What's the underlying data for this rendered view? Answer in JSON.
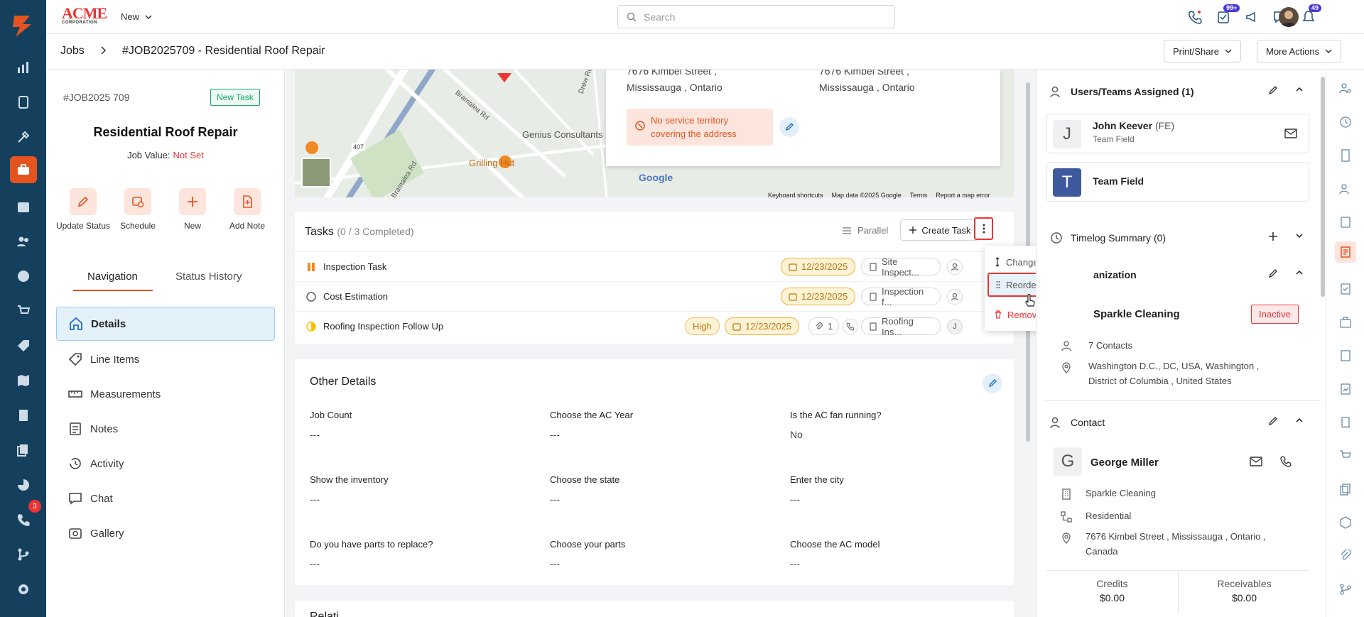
{
  "topbar": {
    "brand": "ACME",
    "brand_sub": "CORPORATION",
    "new_label": "New",
    "search_placeholder": "Search",
    "notif_badge_1": "99+",
    "notif_badge_2": "49"
  },
  "rail": {
    "badge": "3"
  },
  "breadcrumb": {
    "root": "Jobs",
    "current": "#JOB2025709 - Residential Roof Repair",
    "print_share": "Print/Share",
    "more_actions": "More Actions"
  },
  "job": {
    "id": "#JOB2025 709",
    "tag": "New Task",
    "title": "Residential Roof Repair",
    "value_label": "Job Value:",
    "value": "Not Set"
  },
  "quick_actions": [
    {
      "label": "Update Status",
      "icon": "pencil-icon"
    },
    {
      "label": "Schedule",
      "icon": "calendar-clock-icon"
    },
    {
      "label": "New",
      "icon": "plus-icon"
    },
    {
      "label": "Add Note",
      "icon": "note-add-icon"
    }
  ],
  "left_tabs": [
    "Navigation",
    "Status History"
  ],
  "nav": [
    {
      "label": "Details",
      "icon": "home-icon"
    },
    {
      "label": "Line Items",
      "icon": "tag-icon"
    },
    {
      "label": "Measurements",
      "icon": "ruler-icon"
    },
    {
      "label": "Notes",
      "icon": "notes-icon"
    },
    {
      "label": "Activity",
      "icon": "history-icon"
    },
    {
      "label": "Chat",
      "icon": "chat-icon"
    },
    {
      "label": "Gallery",
      "icon": "gallery-icon"
    }
  ],
  "map": {
    "labels": [
      "Genius Consultants",
      "Grilling Hut",
      "Bramalea Rd",
      "Bramalea Rd",
      "Drew Rd",
      "407"
    ],
    "card_addr_1_line1": "7676 Kimbel Street ,",
    "card_addr_1_line2": "Mississauga , Ontario",
    "card_addr_2_line1": "7676 Kimbel Street ,",
    "card_addr_2_line2": "Mississauga , Ontario",
    "no_territory_line1": "No service territory",
    "no_territory_line2": "covering the address",
    "google": "Google",
    "footer": [
      "Keyboard shortcuts",
      "Map data ©2025 Google",
      "Terms",
      "Report a map error"
    ]
  },
  "tasks": {
    "title": "Tasks",
    "progress": "(0 / 3 Completed)",
    "mode": "Parallel",
    "create_label": "Create Task",
    "rows": [
      {
        "name": "Inspection Task",
        "date": "12/23/2025",
        "tag": "Site Inspect...",
        "status_color": "#f08a24"
      },
      {
        "name": "Cost Estimation",
        "date": "12/23/2025",
        "tag": "Inspection f...",
        "status_color": "#555555"
      },
      {
        "name": "Roofing Inspection Follow Up",
        "priority": "High",
        "date": "12/23/2025",
        "attach_count": "1",
        "tag": "Roofing Ins...",
        "assignee": "J",
        "status_color": "#f2c200"
      }
    ]
  },
  "task_menu": {
    "items": [
      "Change to Serial",
      "Reorder Tasks",
      "Remove All"
    ]
  },
  "other_details": {
    "title": "Other Details",
    "fields": [
      {
        "label": "Job Count",
        "value": "---"
      },
      {
        "label": "Choose the AC Year",
        "value": "---"
      },
      {
        "label": "Is the AC fan running?",
        "value": "No"
      },
      {
        "label": "Show the inventory",
        "value": "---"
      },
      {
        "label": "Choose the state",
        "value": "---"
      },
      {
        "label": "Enter the city",
        "value": "---"
      },
      {
        "label": "Do you have parts to replace?",
        "value": "---"
      },
      {
        "label": "Choose your parts",
        "value": "---"
      },
      {
        "label": "Choose the AC model",
        "value": "---"
      }
    ],
    "next_section_title": "Relati"
  },
  "right": {
    "users_title": "Users/Teams Assigned (1)",
    "user_initial": "J",
    "user_name": "John Keever",
    "user_role_tag": "(FE)",
    "user_team": "Team Field",
    "team_initial": "T",
    "team_name": "Team Field",
    "timelog_title": "Timelog Summary (0)",
    "org_title": "Organization",
    "org_title_visible": "anization",
    "org_name": "Sparkle Cleaning",
    "org_status": "Inactive",
    "org_contacts": "7 Contacts",
    "org_addr_line1": "Washington D.C., DC, USA, Washington ,",
    "org_addr_line2": "District of Columbia , United States",
    "contact_title": "Contact",
    "contact_initial": "G",
    "contact_name": "George Miller",
    "contact_company": "Sparkle Cleaning",
    "contact_type": "Residential",
    "contact_addr_line1": "7676 Kimbel Street , Mississauga , Ontario ,",
    "contact_addr_line2": "Canada",
    "credits_label": "Credits",
    "credits_value": "$0.00",
    "receivables_label": "Receivables",
    "receivables_value": "$0.00"
  },
  "colors": {
    "rail": "#14405e",
    "accent": "#e5541f",
    "danger": "#e33333",
    "date_chip": "#f0b232",
    "team_avatar": "#3d5a9e"
  }
}
